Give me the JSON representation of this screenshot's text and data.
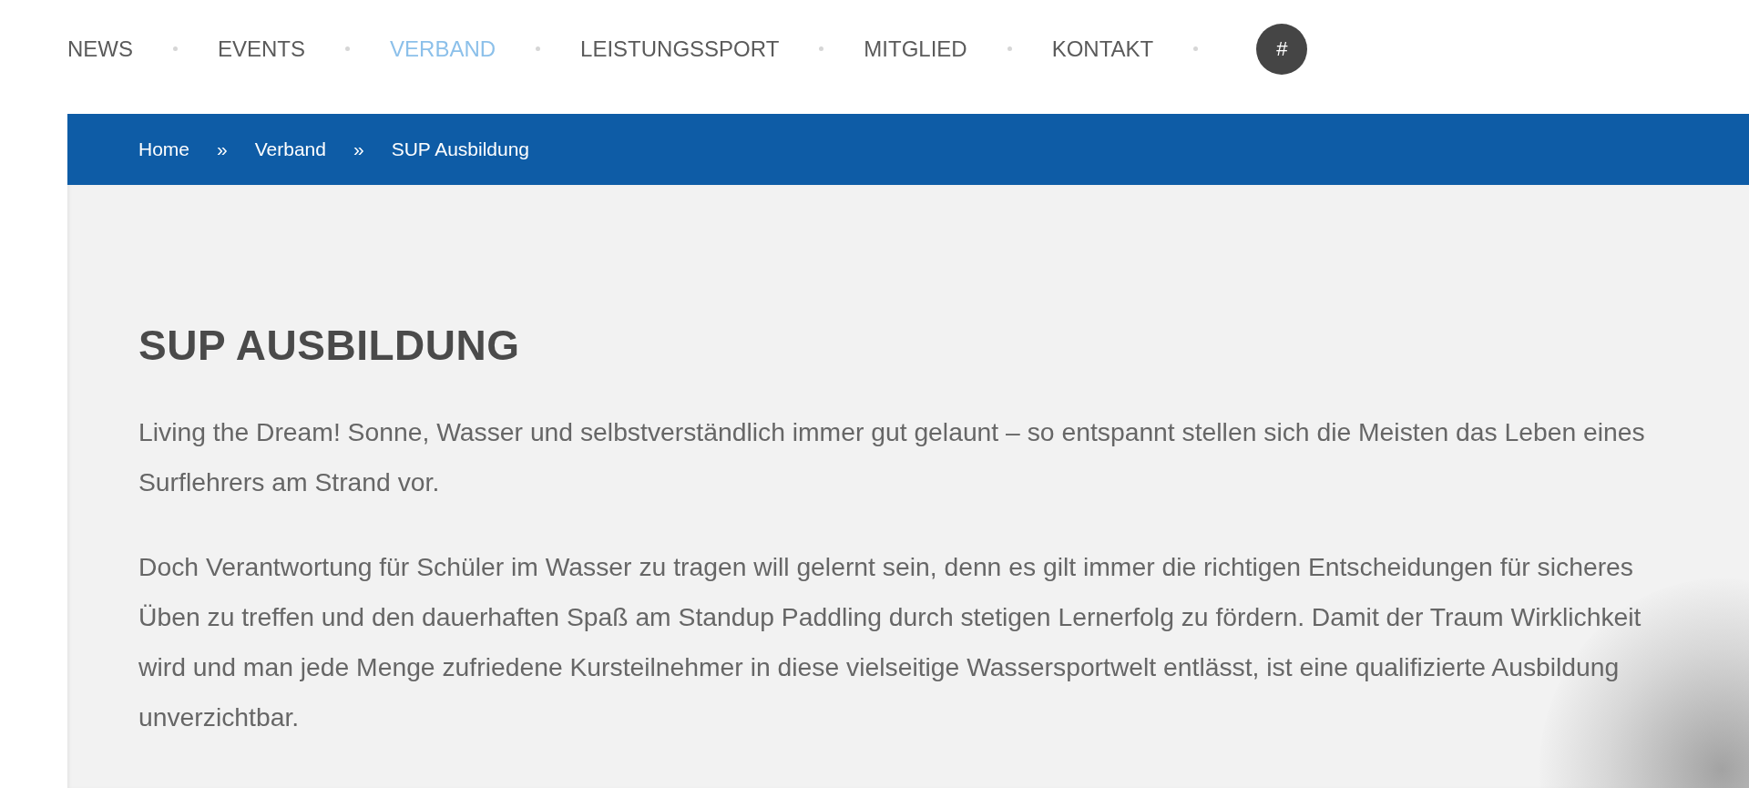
{
  "nav": {
    "items": [
      {
        "label": "NEWS",
        "selected": false
      },
      {
        "label": "EVENTS",
        "selected": false
      },
      {
        "label": "VERBAND",
        "selected": true
      },
      {
        "label": "LEISTUNGSSPORT",
        "selected": false
      },
      {
        "label": "MITGLIED",
        "selected": false
      },
      {
        "label": "KONTAKT",
        "selected": false
      }
    ],
    "hashtag_button": "#"
  },
  "breadcrumb": {
    "items": [
      {
        "label": "Home"
      },
      {
        "separator": "»",
        "label": "Verband"
      },
      {
        "separator": "»",
        "label": "SUP Ausbildung"
      }
    ]
  },
  "content": {
    "heading": "SUP AUSBILDUNG",
    "paragraphs": [
      "Living the Dream! Sonne, Wasser und selbstverständlich immer gut gelaunt – so entspannt stellen sich die Meisten das Leben eines Surflehrers am Strand vor.",
      "Doch Verantwortung für Schüler im Wasser zu tragen will gelernt sein, denn es gilt immer die richtigen Entscheidungen für sicheres Üben zu treffen und den dauerhaften Spaß am Standup Paddling durch stetigen Lernerfolg zu fördern. Damit der Traum Wirklichkeit wird und man jede Menge zufriedene Kursteilnehmer in diese vielseitige Wassersportwelt entlässt, ist eine qualifizierte Ausbildung unverzichtbar."
    ]
  }
}
